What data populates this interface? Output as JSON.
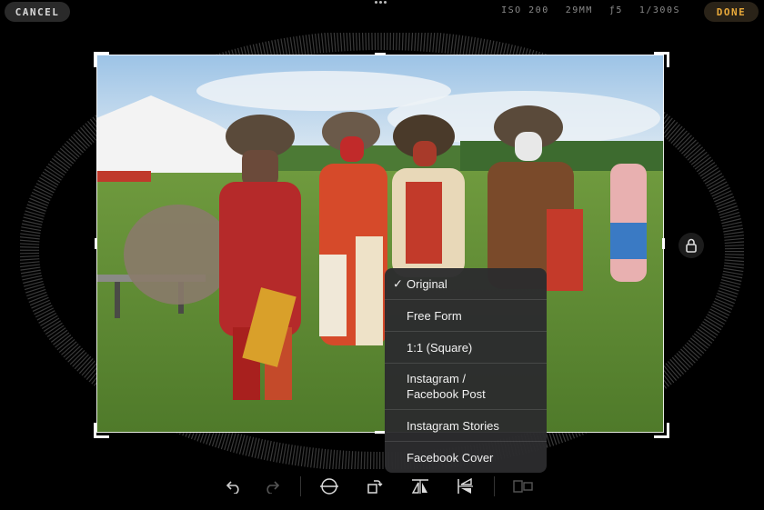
{
  "topbar": {
    "cancel_label": "CANCEL",
    "done_label": "DONE",
    "exif": {
      "iso": "ISO 200",
      "focal": "29MM",
      "aperture": "ƒ5",
      "shutter": "1/300S"
    }
  },
  "colors": {
    "accent": "#e8a93a",
    "menu_bg": "#2c2c2e",
    "background": "#000000"
  },
  "aspect_menu": {
    "items": [
      {
        "label": "Original",
        "checked": true
      },
      {
        "label": "Free Form",
        "checked": false
      },
      {
        "label": "1:1 (Square)",
        "checked": false
      },
      {
        "label": "Instagram /\nFacebook Post",
        "checked": false
      },
      {
        "label": "Instagram Stories",
        "checked": false
      },
      {
        "label": "Facebook Cover",
        "checked": false
      }
    ],
    "check_glyph": "✓"
  },
  "toolbar": {
    "icons": [
      "undo-icon",
      "redo-icon",
      "straighten-icon",
      "rotate-icon",
      "flip-horizontal-icon",
      "flip-vertical-icon",
      "compare-icon"
    ]
  },
  "photo": {
    "subject": "pow-wow dancers in regalia"
  }
}
